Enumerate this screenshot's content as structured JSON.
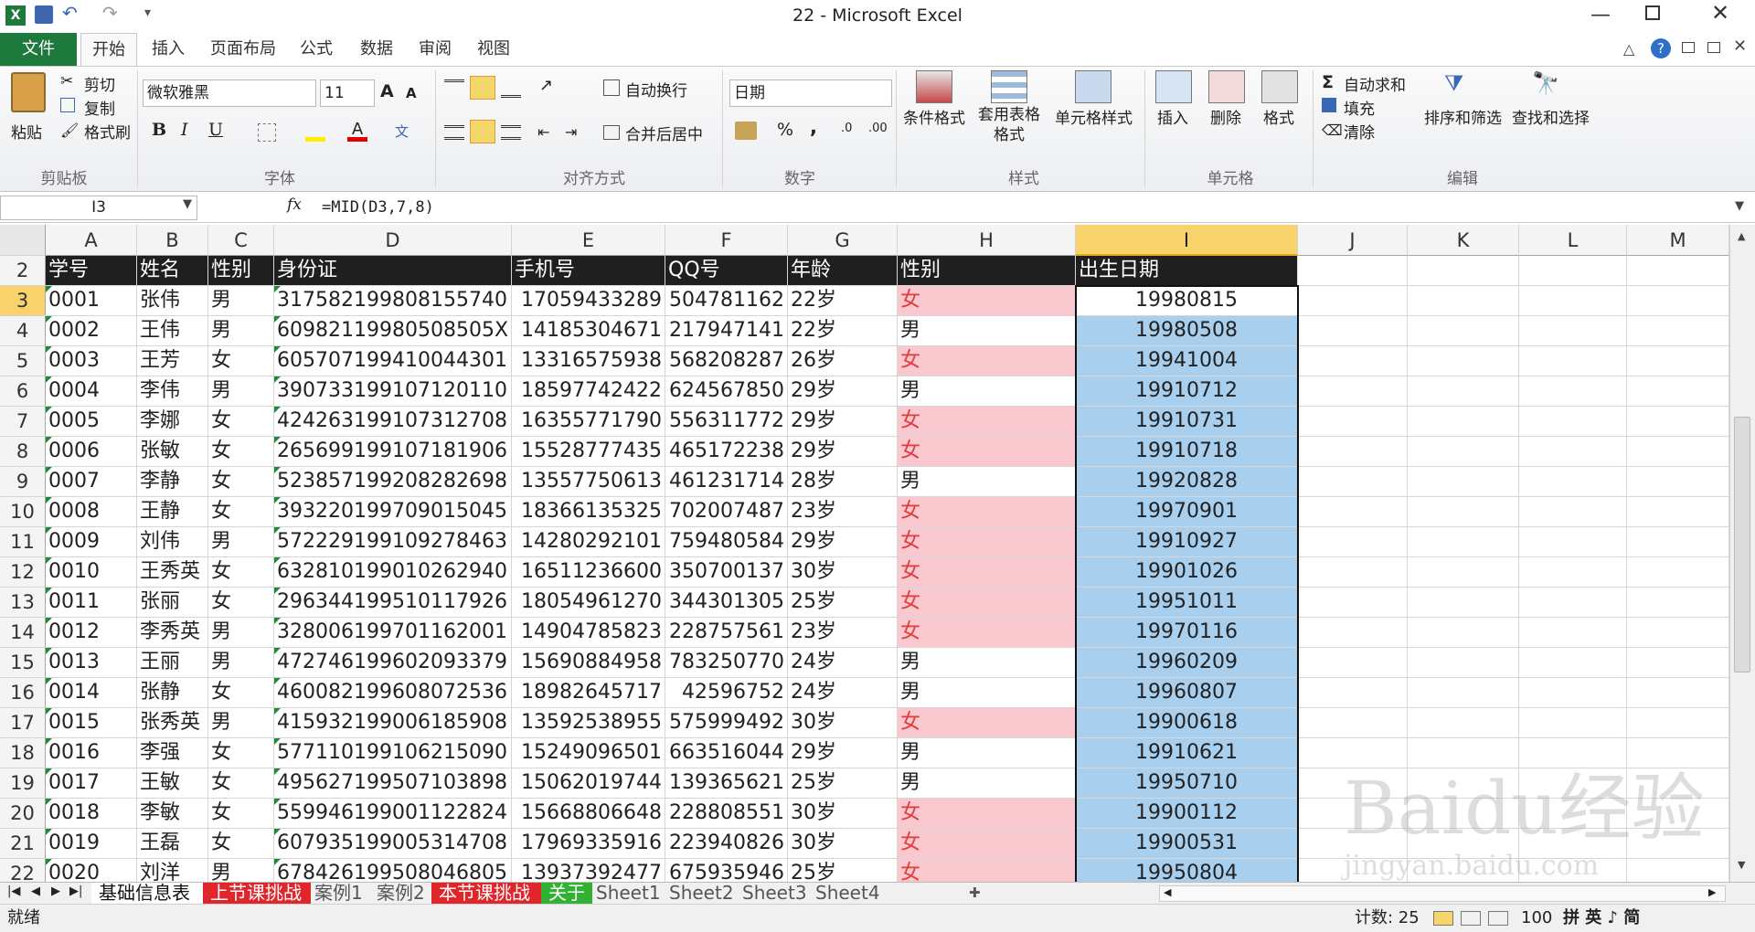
{
  "window": {
    "title": "22 - Microsoft Excel"
  },
  "menu": {
    "file": "文件",
    "tabs": [
      "开始",
      "插入",
      "页面布局",
      "公式",
      "数据",
      "审阅",
      "视图"
    ]
  },
  "ribbon": {
    "clipboard": {
      "paste": "粘贴",
      "cut": "剪切",
      "copy": "复制",
      "format_painter": "格式刷",
      "label": "剪贴板"
    },
    "font": {
      "name": "微软雅黑",
      "size": "11",
      "bold": "B",
      "italic": "I",
      "underline": "U",
      "grow": "A",
      "shrink": "A",
      "label": "字体"
    },
    "align": {
      "wrap": "自动换行",
      "merge": "合并后居中",
      "label": "对齐方式"
    },
    "number": {
      "format": "日期",
      "percent": "%",
      "comma": ",",
      "label": "数字"
    },
    "styles": {
      "cond": "条件格式",
      "table": "套用表格格式",
      "cell": "单元格样式",
      "label": "样式"
    },
    "cells": {
      "insert": "插入",
      "delete": "删除",
      "format": "格式",
      "label": "单元格"
    },
    "edit": {
      "autosum": "自动求和",
      "fill": "填充",
      "clear": "清除",
      "sort": "排序和筛选",
      "find": "查找和选择",
      "label": "编辑"
    }
  },
  "formula_bar": {
    "name_box": "I3",
    "fx": "fx",
    "formula": "=MID(D3,7,8)"
  },
  "columns": [
    "A",
    "B",
    "C",
    "D",
    "E",
    "F",
    "G",
    "H",
    "I",
    "J",
    "K",
    "L",
    "M"
  ],
  "header_row": {
    "num": "2",
    "cells": [
      "学号",
      "姓名",
      "性别",
      "身份证",
      "手机号",
      "QQ号",
      "年龄",
      "性别",
      "出生日期"
    ]
  },
  "rows": [
    {
      "r": "3",
      "id": "0001",
      "name": "张伟",
      "sex": "男",
      "idcard": "317582199808155740",
      "phone": "17059433289",
      "qq": "504781162",
      "age": "22岁",
      "sex2": "女",
      "birth": "19980815"
    },
    {
      "r": "4",
      "id": "0002",
      "name": "王伟",
      "sex": "男",
      "idcard": "60982119980508505X",
      "phone": "14185304671",
      "qq": "217947141",
      "age": "22岁",
      "sex2": "男",
      "birth": "19980508"
    },
    {
      "r": "5",
      "id": "0003",
      "name": "王芳",
      "sex": "女",
      "idcard": "605707199410044301",
      "phone": "13316575938",
      "qq": "568208287",
      "age": "26岁",
      "sex2": "女",
      "birth": "19941004"
    },
    {
      "r": "6",
      "id": "0004",
      "name": "李伟",
      "sex": "男",
      "idcard": "390733199107120110",
      "phone": "18597742422",
      "qq": "624567850",
      "age": "29岁",
      "sex2": "男",
      "birth": "19910712"
    },
    {
      "r": "7",
      "id": "0005",
      "name": "李娜",
      "sex": "女",
      "idcard": "424263199107312708",
      "phone": "16355771790",
      "qq": "556311772",
      "age": "29岁",
      "sex2": "女",
      "birth": "19910731"
    },
    {
      "r": "8",
      "id": "0006",
      "name": "张敏",
      "sex": "女",
      "idcard": "265699199107181906",
      "phone": "15528777435",
      "qq": "465172238",
      "age": "29岁",
      "sex2": "女",
      "birth": "19910718"
    },
    {
      "r": "9",
      "id": "0007",
      "name": "李静",
      "sex": "女",
      "idcard": "523857199208282698",
      "phone": "13557750613",
      "qq": "461231714",
      "age": "28岁",
      "sex2": "男",
      "birth": "19920828"
    },
    {
      "r": "10",
      "id": "0008",
      "name": "王静",
      "sex": "女",
      "idcard": "393220199709015045",
      "phone": "18366135325",
      "qq": "702007487",
      "age": "23岁",
      "sex2": "女",
      "birth": "19970901"
    },
    {
      "r": "11",
      "id": "0009",
      "name": "刘伟",
      "sex": "男",
      "idcard": "572229199109278463",
      "phone": "14280292101",
      "qq": "759480584",
      "age": "29岁",
      "sex2": "女",
      "birth": "19910927"
    },
    {
      "r": "12",
      "id": "0010",
      "name": "王秀英",
      "sex": "女",
      "idcard": "632810199010262940",
      "phone": "16511236600",
      "qq": "350700137",
      "age": "30岁",
      "sex2": "女",
      "birth": "19901026"
    },
    {
      "r": "13",
      "id": "0011",
      "name": "张丽",
      "sex": "女",
      "idcard": "296344199510117926",
      "phone": "18054961270",
      "qq": "344301305",
      "age": "25岁",
      "sex2": "女",
      "birth": "19951011"
    },
    {
      "r": "14",
      "id": "0012",
      "name": "李秀英",
      "sex": "男",
      "idcard": "328006199701162001",
      "phone": "14904785823",
      "qq": "228757561",
      "age": "23岁",
      "sex2": "女",
      "birth": "19970116"
    },
    {
      "r": "15",
      "id": "0013",
      "name": "王丽",
      "sex": "男",
      "idcard": "472746199602093379",
      "phone": "15690884958",
      "qq": "783250770",
      "age": "24岁",
      "sex2": "男",
      "birth": "19960209"
    },
    {
      "r": "16",
      "id": "0014",
      "name": "张静",
      "sex": "女",
      "idcard": "460082199608072536",
      "phone": "18982645717",
      "qq": "42596752",
      "age": "24岁",
      "sex2": "男",
      "birth": "19960807"
    },
    {
      "r": "17",
      "id": "0015",
      "name": "张秀英",
      "sex": "男",
      "idcard": "415932199006185908",
      "phone": "13592538955",
      "qq": "575999492",
      "age": "30岁",
      "sex2": "女",
      "birth": "19900618"
    },
    {
      "r": "18",
      "id": "0016",
      "name": "李强",
      "sex": "女",
      "idcard": "577110199106215090",
      "phone": "15249096501",
      "qq": "663516044",
      "age": "29岁",
      "sex2": "男",
      "birth": "19910621"
    },
    {
      "r": "19",
      "id": "0017",
      "name": "王敏",
      "sex": "女",
      "idcard": "495627199507103898",
      "phone": "15062019744",
      "qq": "139365621",
      "age": "25岁",
      "sex2": "男",
      "birth": "19950710"
    },
    {
      "r": "20",
      "id": "0018",
      "name": "李敏",
      "sex": "女",
      "idcard": "559946199001122824",
      "phone": "15668806648",
      "qq": "228808551",
      "age": "30岁",
      "sex2": "女",
      "birth": "19900112"
    },
    {
      "r": "21",
      "id": "0019",
      "name": "王磊",
      "sex": "女",
      "idcard": "607935199005314708",
      "phone": "17969335916",
      "qq": "223940826",
      "age": "30岁",
      "sex2": "女",
      "birth": "19900531"
    },
    {
      "r": "22",
      "id": "0020",
      "name": "刘洋",
      "sex": "男",
      "idcard": "678426199508046805",
      "phone": "13937392477",
      "qq": "675935946",
      "age": "25岁",
      "sex2": "女",
      "birth": "19950804"
    }
  ],
  "sheet_tabs": [
    "基础信息表",
    "上节课挑战",
    "案例1",
    "案例2",
    "本节课挑战",
    "关于",
    "Sheet1",
    "Sheet2",
    "Sheet3",
    "Sheet4"
  ],
  "status": {
    "ready": "就绪",
    "count": "计数: 25",
    "zoom": "100",
    "ime": "拼 英 ♪ 简"
  },
  "watermark": "Baidu经验",
  "watermark_sub": "jingyan.baidu.com"
}
